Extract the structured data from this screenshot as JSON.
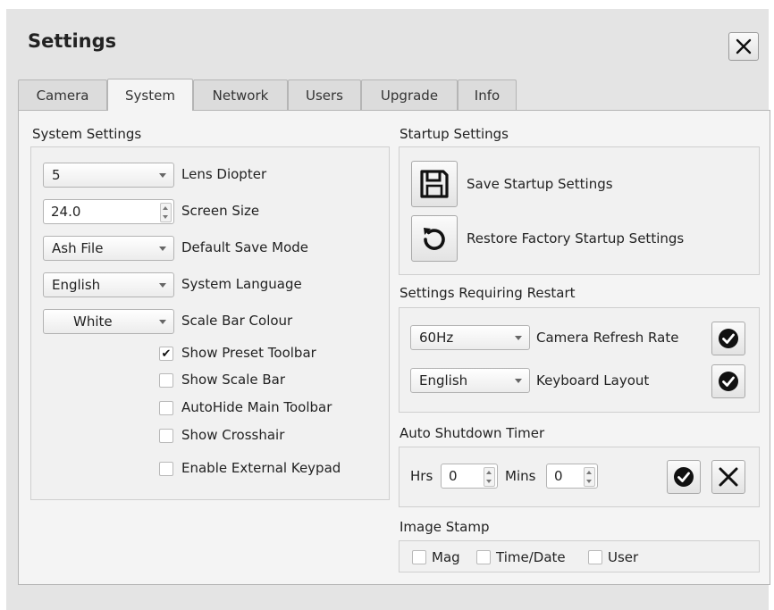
{
  "dialog": {
    "title": "Settings"
  },
  "tabs": [
    {
      "label": "Camera"
    },
    {
      "label": "System"
    },
    {
      "label": "Network"
    },
    {
      "label": "Users"
    },
    {
      "label": "Upgrade"
    },
    {
      "label": "Info"
    }
  ],
  "active_tab": "System",
  "system_settings": {
    "heading": "System Settings",
    "lens_diopter": {
      "value": "5",
      "label": "Lens Diopter"
    },
    "screen_size": {
      "value": "24.0",
      "label": "Screen Size"
    },
    "default_save_mode": {
      "value": "Ash File",
      "label": "Default Save Mode"
    },
    "system_language": {
      "value": "English",
      "label": "System Language"
    },
    "scale_bar_colour": {
      "value": "White",
      "label": "Scale Bar Colour"
    },
    "checkboxes": [
      {
        "label": "Show Preset Toolbar",
        "checked": true
      },
      {
        "label": "Show Scale Bar",
        "checked": false
      },
      {
        "label": "AutoHide Main Toolbar",
        "checked": false
      },
      {
        "label": "Show Crosshair",
        "checked": false
      },
      {
        "label": "Enable External Keypad",
        "checked": false
      }
    ]
  },
  "startup_settings": {
    "heading": "Startup Settings",
    "save_label": "Save Startup Settings",
    "restore_label": "Restore Factory Startup Settings"
  },
  "restart_settings": {
    "heading": "Settings Requiring Restart",
    "refresh_rate": {
      "value": "60Hz",
      "label": "Camera Refresh Rate"
    },
    "keyboard_layout": {
      "value": "English",
      "label": "Keyboard Layout"
    }
  },
  "auto_shutdown": {
    "heading": "Auto Shutdown Timer",
    "hrs_label": "Hrs",
    "hrs_value": "0",
    "mins_label": "Mins",
    "mins_value": "0"
  },
  "image_stamp": {
    "heading": "Image Stamp",
    "options": [
      {
        "label": "Mag",
        "checked": false
      },
      {
        "label": "Time/Date",
        "checked": false
      },
      {
        "label": "User",
        "checked": false
      }
    ]
  },
  "colors": {
    "window_bg": "#e4e4e4",
    "panel_bg": "#f4f4f4",
    "icon": "#111111"
  },
  "icons": {
    "close": "close-icon",
    "save": "floppy-disk-icon",
    "restore": "restore-arrow-icon",
    "apply": "check-circle-icon",
    "cancel": "x-icon"
  }
}
